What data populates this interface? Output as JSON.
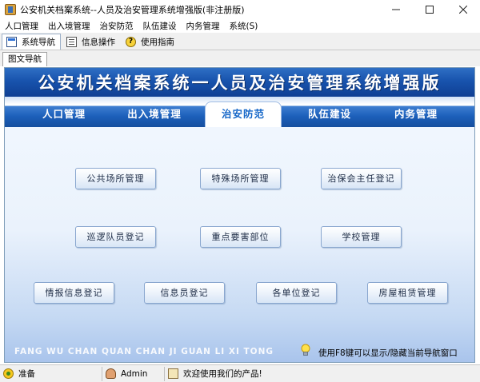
{
  "window": {
    "title": "公安机关档案系统--人员及治安管理系统增强版(非注册版)",
    "controls": [
      "minimize",
      "maximize",
      "close"
    ]
  },
  "menubar": {
    "items": [
      "人口管理",
      "出入境管理",
      "治安防范",
      "队伍建设",
      "内务管理",
      "系统(S)"
    ]
  },
  "toolbar": {
    "items": [
      {
        "label": "系统导航",
        "icon": "nav-icon",
        "active": true
      },
      {
        "label": "信息操作",
        "icon": "info-icon",
        "active": false
      },
      {
        "label": "使用指南",
        "icon": "help-icon",
        "active": false
      }
    ]
  },
  "subtab": {
    "label": "图文导航"
  },
  "banner": {
    "title": "公安机关档案系统一人员及治安管理系统增强版"
  },
  "nav": {
    "tabs": [
      "人口管理",
      "出入境管理",
      "治安防范",
      "队伍建设",
      "内务管理"
    ],
    "active": "治安防范"
  },
  "functions": {
    "row1": [
      "公共场所管理",
      "特殊场所管理",
      "治保会主任登记"
    ],
    "row2": [
      "巡逻队员登记",
      "重点要害部位",
      "学校管理"
    ],
    "row3": [
      "情报信息登记",
      "信息员登记",
      "各单位登记",
      "房屋租赁管理"
    ]
  },
  "footer": {
    "pinyin": "FANG WU CHAN QUAN CHAN JI GUAN LI XI TONG",
    "hint": "使用F8键可以显示/隐藏当前导航窗口",
    "bulb_icon": "lightbulb-icon"
  },
  "statusbar": {
    "status": "准备",
    "user": "Admin",
    "welcome": "欢迎使用我们的产品!"
  },
  "colors": {
    "banner": "#1853ad",
    "nav_active_text": "#1466c8",
    "panel_bottom": "#a9c4ec"
  }
}
